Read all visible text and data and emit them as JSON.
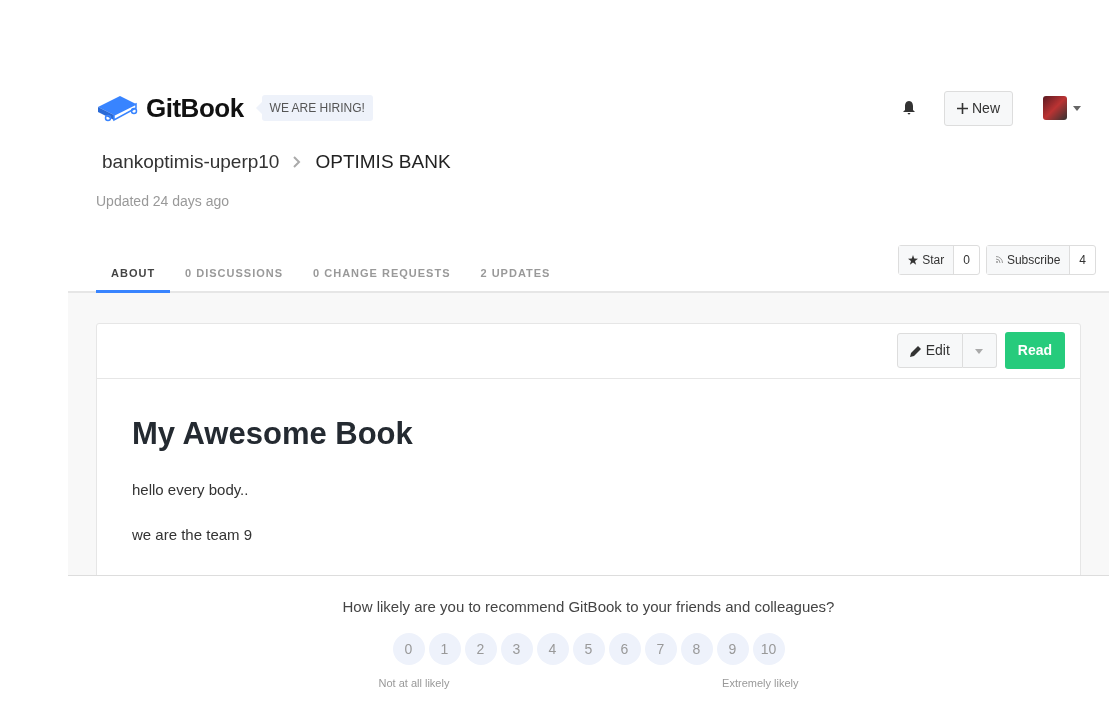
{
  "header": {
    "logo": "GitBook",
    "hiring_badge": "WE ARE HIRING!",
    "new_button": "New"
  },
  "breadcrumb": {
    "owner": "bankoptimis-uperp10",
    "book": "OPTIMIS BANK"
  },
  "updated": "Updated 24 days ago",
  "tabs": [
    {
      "label": "ABOUT",
      "selected": true
    },
    {
      "label": "0 DISCUSSIONS",
      "selected": false
    },
    {
      "label": "0 CHANGE REQUESTS",
      "selected": false
    },
    {
      "label": "2 UPDATES",
      "selected": false
    }
  ],
  "star": {
    "label": "Star",
    "count": "0"
  },
  "subscribe": {
    "label": "Subscribe",
    "count": "4"
  },
  "card": {
    "edit_button": "Edit",
    "read_button": "Read",
    "title": "My Awesome Book",
    "paragraphs": [
      "hello every body..",
      "we are the team 9"
    ]
  },
  "survey": {
    "question": "How likely are you to recommend GitBook to your friends and colleagues?",
    "scores": [
      "0",
      "1",
      "2",
      "3",
      "4",
      "5",
      "6",
      "7",
      "8",
      "9",
      "10"
    ],
    "low_label": "Not at all likely",
    "high_label": "Extremely likely"
  }
}
